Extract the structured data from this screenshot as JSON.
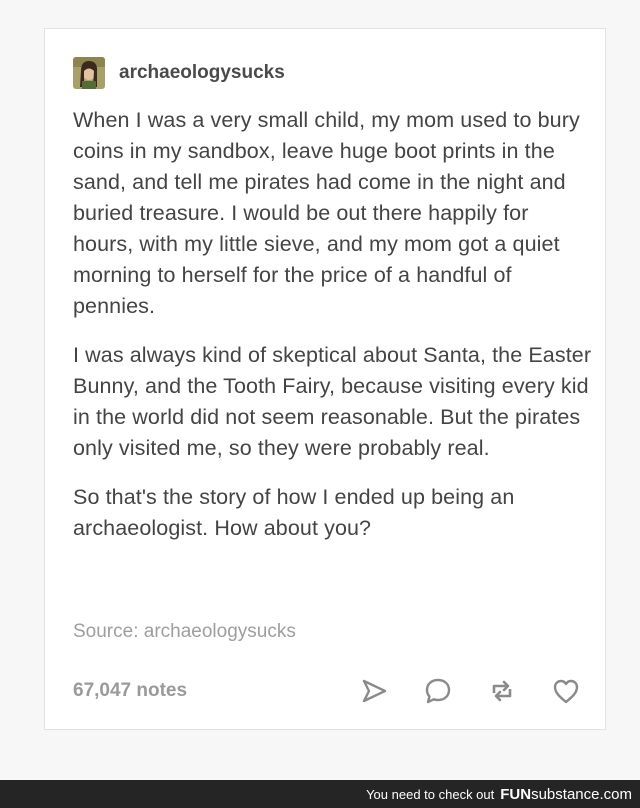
{
  "post": {
    "username": "archaeologysucks",
    "paragraphs": [
      "When I was a very small child, my mom used to bury coins in my sandbox, leave huge boot prints in the sand, and tell me pirates had come in the night and buried treasure. I would be out there happily for hours, with my little sieve, and my mom got a quiet morning to herself for the price of a handful of pennies.",
      "I was always kind of skeptical about Santa, the Easter Bunny, and the Tooth Fairy, because visiting every kid in the world did not seem reasonable. But the pirates only visited me, so they were probably real.",
      "So that's the story of how I ended up being an archaeologist. How about you?"
    ],
    "source": "Source: archaeologysucks",
    "notes": "67,047 notes",
    "icons": [
      "share-icon",
      "reply-icon",
      "reblog-icon",
      "like-icon"
    ]
  },
  "watermark": {
    "prefix": "You need to check out",
    "brand_fun": "FUN",
    "brand_sub": "substance",
    "brand_com": ".com"
  },
  "colors": {
    "text": "#444444",
    "muted": "#9e9e9e",
    "card": "#ffffff",
    "background": "#f7f7f7",
    "watermark_bar": "#252525"
  }
}
